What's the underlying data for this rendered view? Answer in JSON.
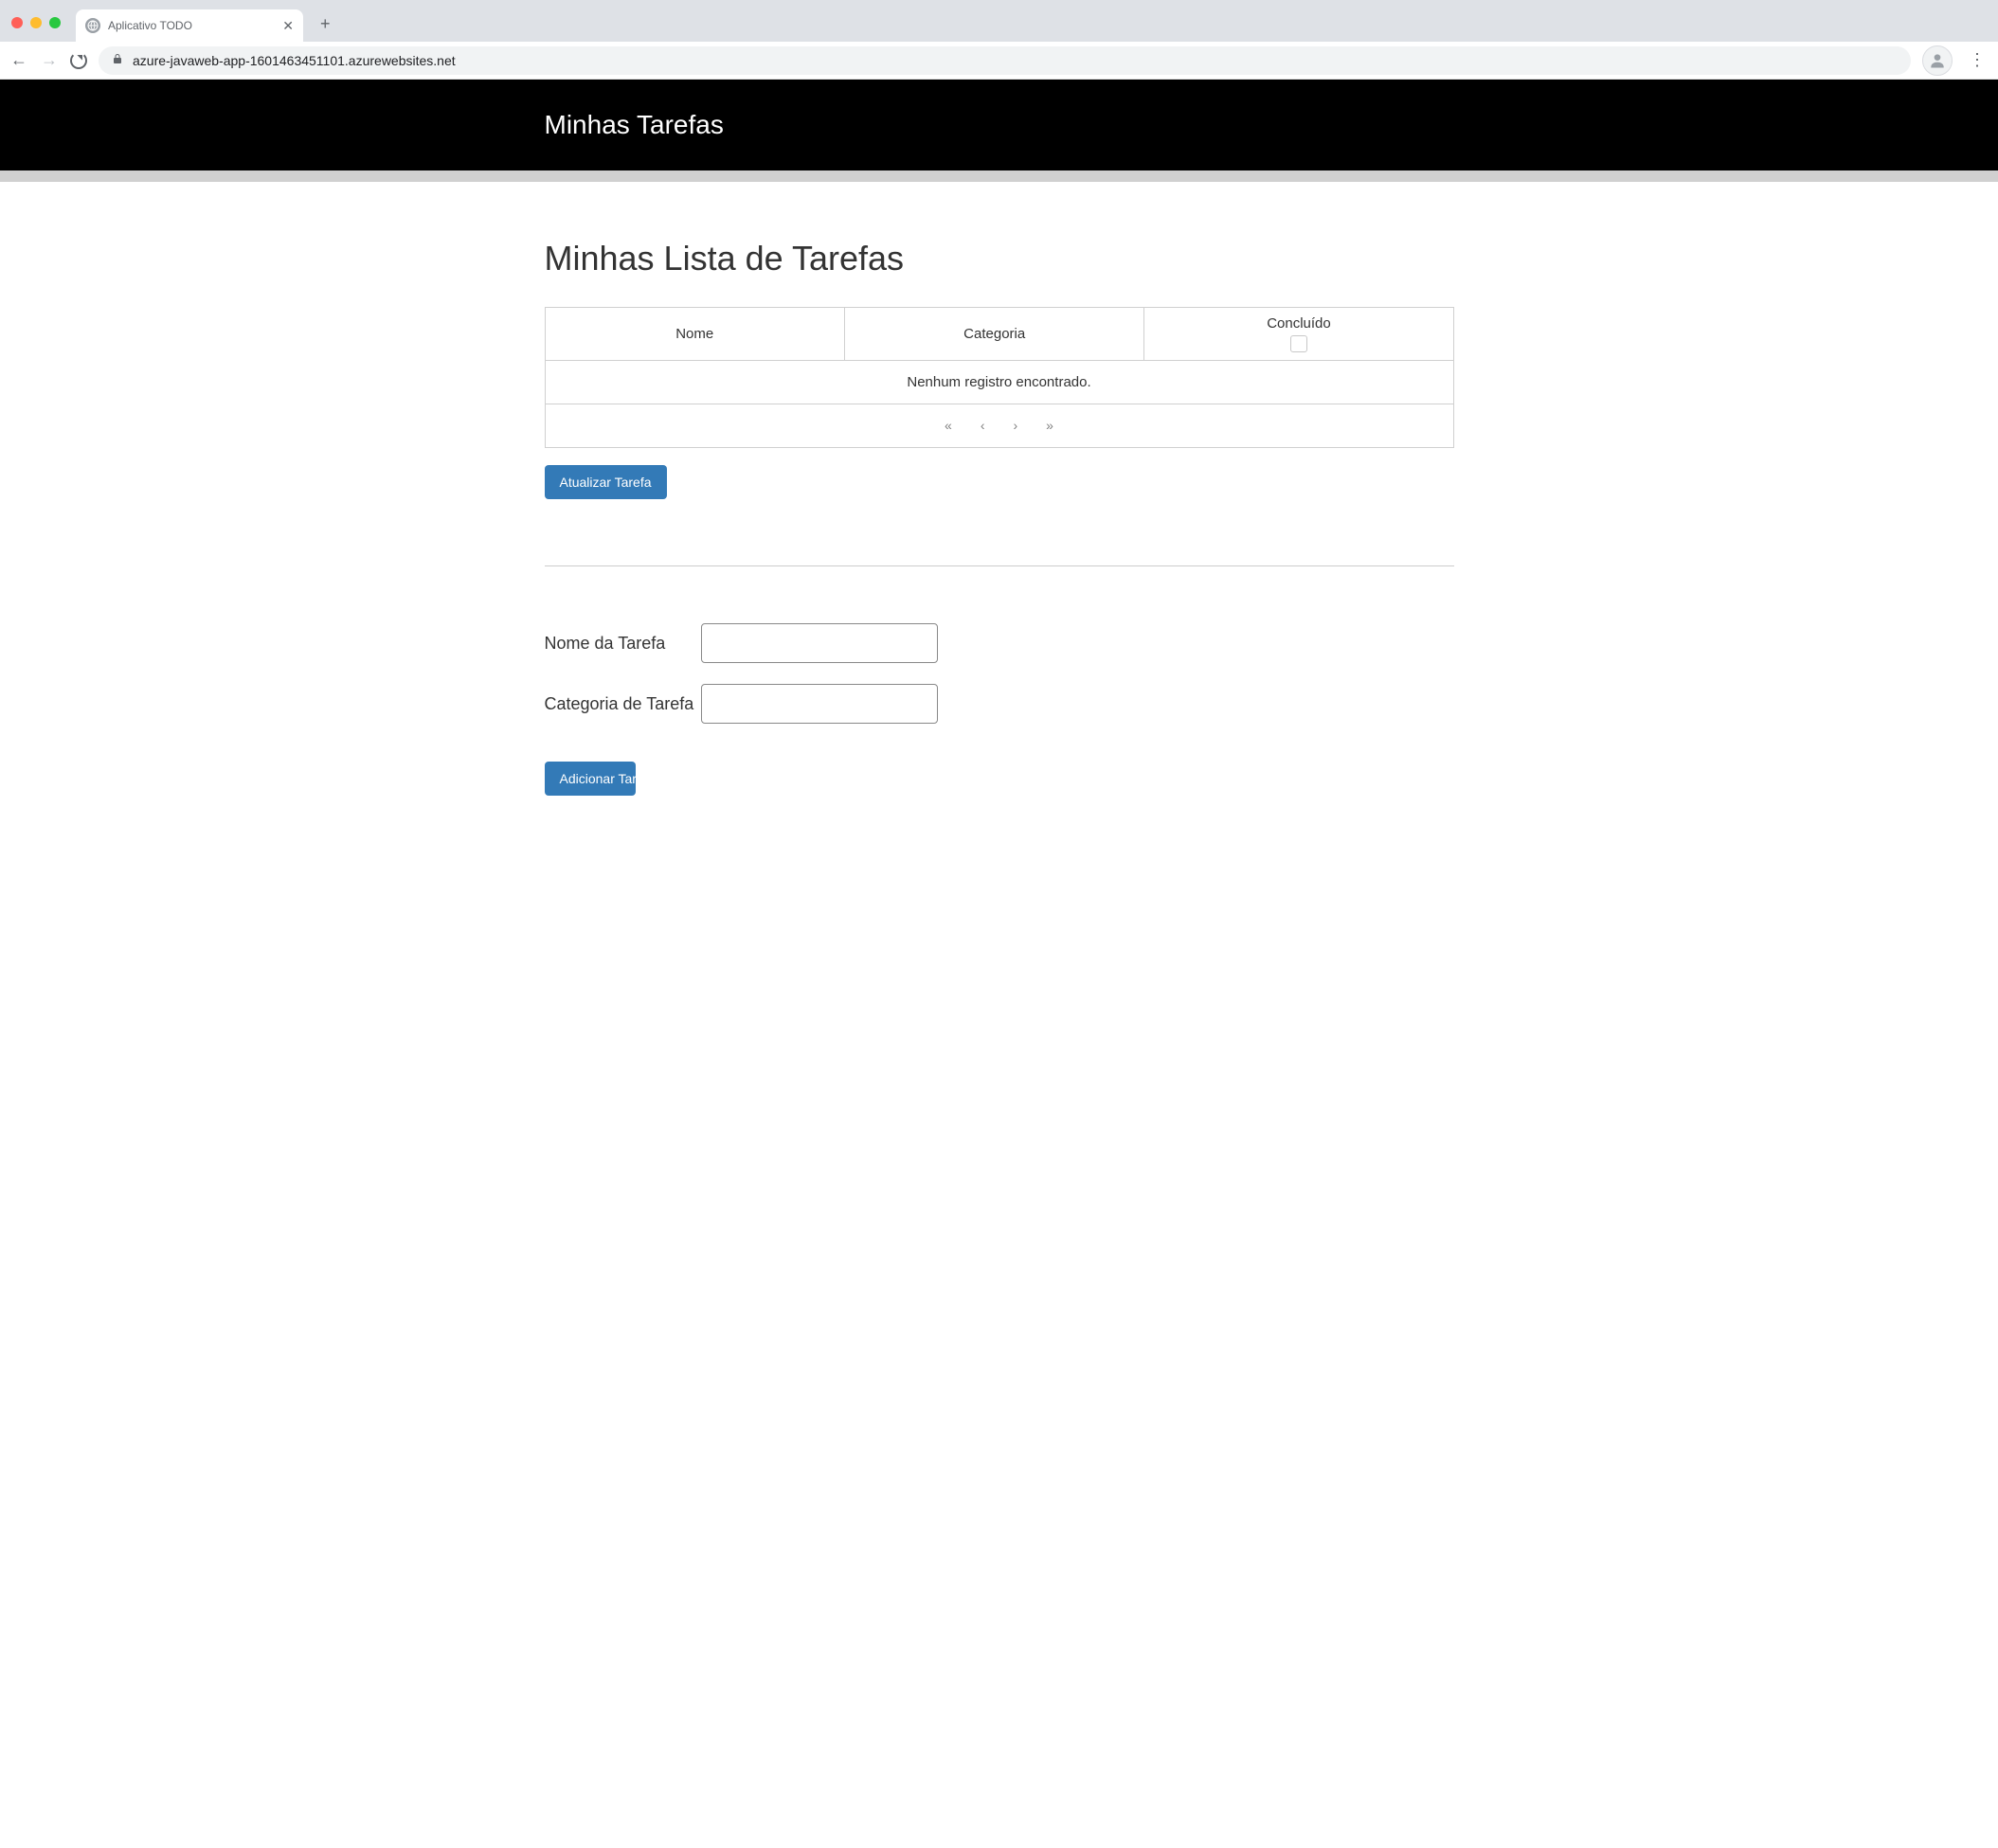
{
  "browser": {
    "tab_title": "Aplicativo TODO",
    "url": "azure-javaweb-app-1601463451101.azurewebsites.net"
  },
  "header": {
    "title": "Minhas Tarefas"
  },
  "main": {
    "title": "Minhas Lista de Tarefas",
    "columns": {
      "name": "Nome",
      "category": "Categoria",
      "complete": "Concluído"
    },
    "empty_message": "Nenhum registro encontrado.",
    "update_button": "Atualizar Tarefa"
  },
  "form": {
    "name_label": "Nome da Tarefa",
    "category_label": "Categoria de Tarefa",
    "name_value": "",
    "category_value": "",
    "add_button": "Adicionar Tarefa"
  }
}
